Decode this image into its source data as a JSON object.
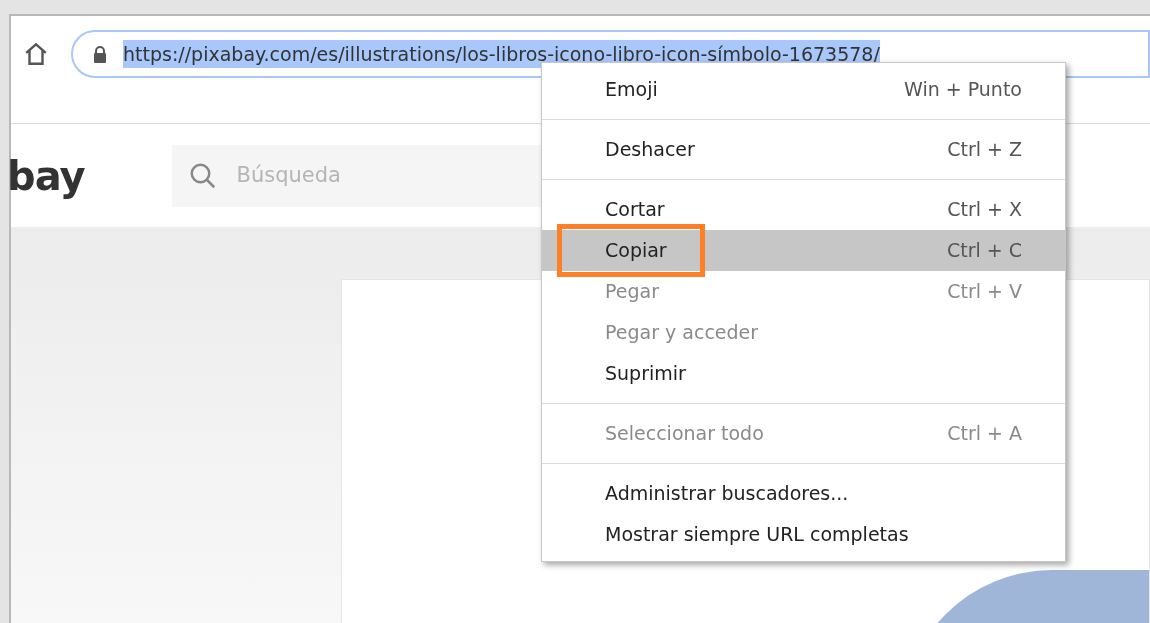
{
  "address_bar": {
    "url": "https://pixabay.com/es/illustrations/los-libros-icono-libro-icon-símbolo-1673578/",
    "selected": true
  },
  "site_header": {
    "logo_text": "bay",
    "search": {
      "placeholder": "Búsqueda"
    }
  },
  "context_menu": {
    "items": [
      {
        "kind": "item",
        "label": "Emoji",
        "shortcut": "Win + Punto",
        "disabled": false,
        "selected": false,
        "highlighted": false
      },
      {
        "kind": "divider"
      },
      {
        "kind": "item",
        "label": "Deshacer",
        "shortcut": "Ctrl + Z",
        "disabled": false,
        "selected": false,
        "highlighted": false
      },
      {
        "kind": "divider"
      },
      {
        "kind": "item",
        "label": "Cortar",
        "shortcut": "Ctrl + X",
        "disabled": false,
        "selected": false,
        "highlighted": false
      },
      {
        "kind": "item",
        "label": "Copiar",
        "shortcut": "Ctrl + C",
        "disabled": false,
        "selected": true,
        "highlighted": true
      },
      {
        "kind": "item",
        "label": "Pegar",
        "shortcut": "Ctrl + V",
        "disabled": true,
        "selected": false,
        "highlighted": false
      },
      {
        "kind": "item",
        "label": "Pegar y acceder",
        "disabled": true,
        "selected": false,
        "highlighted": false
      },
      {
        "kind": "item",
        "label": "Suprimir",
        "disabled": false,
        "selected": false,
        "highlighted": false
      },
      {
        "kind": "divider"
      },
      {
        "kind": "item",
        "label": "Seleccionar todo",
        "shortcut": "Ctrl + A",
        "disabled": true,
        "selected": false,
        "highlighted": false
      },
      {
        "kind": "divider"
      },
      {
        "kind": "item",
        "label": "Administrar buscadores...",
        "disabled": false,
        "selected": false,
        "highlighted": false
      },
      {
        "kind": "item",
        "label": "Mostrar siempre URL completas",
        "disabled": false,
        "selected": false,
        "highlighted": false
      }
    ]
  }
}
